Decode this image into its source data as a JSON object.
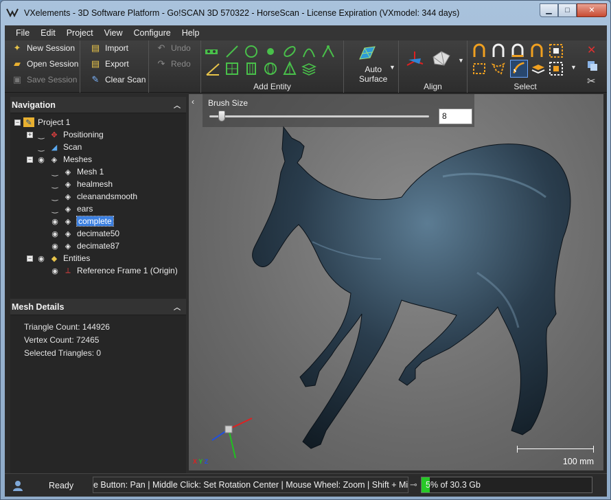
{
  "window": {
    "title": "VXelements - 3D Software Platform - Go!SCAN 3D 570322 - HorseScan - License Expiration (VXmodel: 344 days)",
    "min_label": "▁",
    "max_label": "□",
    "close_label": "✕"
  },
  "menu": [
    "File",
    "Edit",
    "Project",
    "View",
    "Configure",
    "Help"
  ],
  "ribbon": {
    "session": {
      "new_session": "New Session",
      "open_session": "Open Session",
      "save_session": "Save Session"
    },
    "scan": {
      "import": "Import",
      "export": "Export",
      "clear_scan": "Clear Scan"
    },
    "history": {
      "undo": "Undo",
      "redo": "Redo"
    },
    "add_entity_label": "Add Entity",
    "auto_surface_line1": "Auto",
    "auto_surface_line2": "Surface",
    "align_label": "Align",
    "select_label": "Select"
  },
  "navigation": {
    "title": "Navigation",
    "nodes": {
      "project": "Project 1",
      "positioning": "Positioning",
      "scan": "Scan",
      "meshes": "Meshes",
      "mesh1": "Mesh 1",
      "healmesh": "healmesh",
      "cleanandsmooth": "cleanandsmooth",
      "ears": "ears",
      "complete": "complete",
      "decimate50": "decimate50",
      "decimate87": "decimate87",
      "entities": "Entities",
      "reference_frame": "Reference Frame 1 (Origin)"
    }
  },
  "mesh_details": {
    "title": "Mesh Details",
    "triangle_count": "Triangle Count: 144926",
    "vertex_count": "Vertex Count: 72465",
    "selected_triangles": "Selected Triangles: 0"
  },
  "viewport": {
    "brush_size_label": "Brush Size",
    "brush_size_value": "8",
    "brush_fraction": 0.04,
    "scale_label": "100 mm",
    "axis_x": "X",
    "axis_y": "Y",
    "axis_z": "Z"
  },
  "status": {
    "ready": "Ready",
    "hint": "e Button: Pan  |  Middle Click: Set Rotation Center  |  Mouse Wheel: Zoom  |  Shift + Mid",
    "memory": "5% of 30.3 Gb",
    "memory_fraction": 0.05
  },
  "colors": {
    "accent": "#3b7fe0",
    "memory_bar": "#27c927",
    "axis_x": "#e02020",
    "axis_y": "#20c020",
    "axis_z": "#2050e0"
  }
}
